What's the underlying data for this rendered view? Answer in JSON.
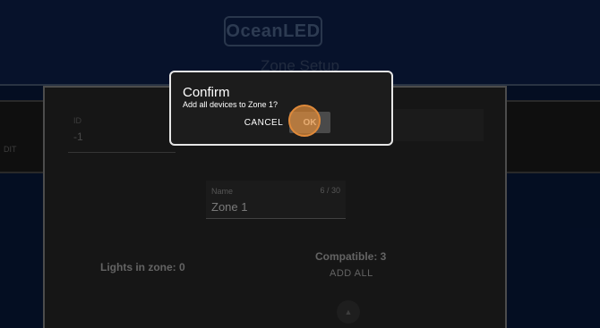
{
  "app": {
    "logo_text": "OceanLED",
    "title": "Zone Setup",
    "left_strip_text": "DIT"
  },
  "zone_editor": {
    "id_label": "ID",
    "id_value": "-1",
    "name_label": "Name",
    "name_counter": "6 / 30",
    "name_value": "Zone 1",
    "lights_in_zone": "Lights in zone: 0",
    "compatible": "Compatible: 3",
    "add_all_label": "ADD ALL",
    "scroll_up_icon": "chevron-up-icon"
  },
  "confirm_dialog": {
    "title": "Confirm",
    "message": "Add all devices to Zone 1?",
    "cancel_label": "CANCEL",
    "ok_label": "OK"
  },
  "colors": {
    "background": "#061430",
    "panel": "#1f1f1f",
    "dialog_border": "#e6e6e6",
    "touch_indicator": "#e08a3a"
  }
}
